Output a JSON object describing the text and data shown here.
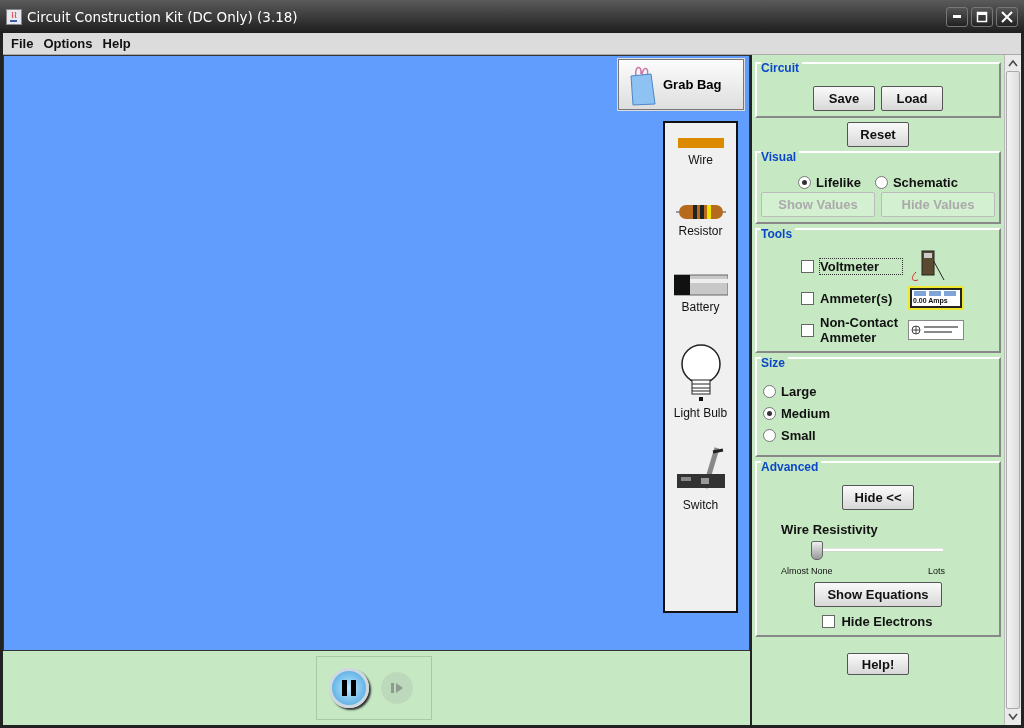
{
  "window": {
    "title": "Circuit Construction Kit (DC Only) (3.18)"
  },
  "menu": [
    "File",
    "Options",
    "Help"
  ],
  "grab_bag": {
    "label": "Grab Bag"
  },
  "toolbox": [
    {
      "kind": "wire",
      "label": "Wire"
    },
    {
      "kind": "resistor",
      "label": "Resistor"
    },
    {
      "kind": "battery",
      "label": "Battery"
    },
    {
      "kind": "bulb",
      "label": "Light Bulb"
    },
    {
      "kind": "switch",
      "label": "Switch"
    }
  ],
  "playback": {
    "running": true,
    "step_disabled": true
  },
  "panel": {
    "circuit": {
      "title": "Circuit",
      "buttons": [
        "Save",
        "Load"
      ]
    },
    "reset": "Reset",
    "visual": {
      "title": "Visual",
      "options": [
        {
          "label": "Lifelike",
          "selected": true
        },
        {
          "label": "Schematic",
          "selected": false
        }
      ],
      "buttons": [
        {
          "label": "Show Values",
          "disabled": true
        },
        {
          "label": "Hide Values",
          "disabled": true
        }
      ]
    },
    "tools": {
      "title": "Tools",
      "items": [
        {
          "kind": "voltmeter",
          "label": "Voltmeter",
          "checked": false,
          "focused": true
        },
        {
          "kind": "ammeter",
          "label": "Ammeter(s)",
          "checked": false,
          "focused": false,
          "readout": "0.00 Amps"
        },
        {
          "kind": "noncontact",
          "label": "Non-Contact Ammeter",
          "checked": false,
          "focused": false
        }
      ]
    },
    "size": {
      "title": "Size",
      "options": [
        {
          "label": "Large",
          "selected": false
        },
        {
          "label": "Medium",
          "selected": true
        },
        {
          "label": "Small",
          "selected": false
        }
      ]
    },
    "advanced": {
      "title": "Advanced",
      "toggle": "Hide <<",
      "slider": {
        "label": "Wire Resistivity",
        "level": 0.0,
        "min_label": "Almost None",
        "max_label": "Lots"
      },
      "equations": "Show Equations",
      "hide_electrons": {
        "label": "Hide Electrons",
        "checked": false
      }
    },
    "help": "Help!"
  }
}
